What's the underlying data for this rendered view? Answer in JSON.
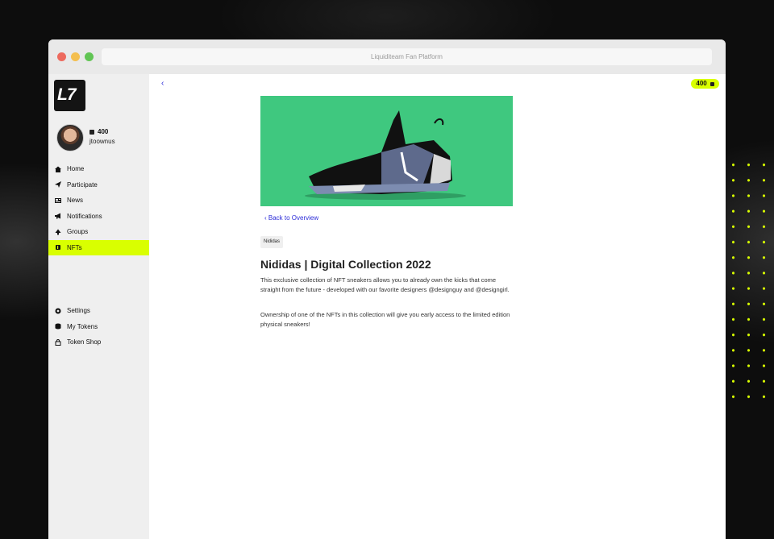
{
  "window": {
    "title": "Liquiditeam Fan Platform"
  },
  "brand": {
    "logo_text": "L7"
  },
  "user": {
    "tokens": "400",
    "username": "jtoownus"
  },
  "nav_main": [
    {
      "label": "Home",
      "icon": "home-icon"
    },
    {
      "label": "Participate",
      "icon": "paper-plane-icon"
    },
    {
      "label": "News",
      "icon": "newspaper-icon"
    },
    {
      "label": "Notifications",
      "icon": "megaphone-icon"
    },
    {
      "label": "Groups",
      "icon": "people-icon"
    },
    {
      "label": "NFTs",
      "icon": "nft-icon",
      "active": true
    }
  ],
  "nav_secondary": [
    {
      "label": "Settings",
      "icon": "gear-icon"
    },
    {
      "label": "My Tokens",
      "icon": "coins-icon"
    },
    {
      "label": "Token Shop",
      "icon": "shopping-bag-icon"
    }
  ],
  "header": {
    "balance": "400"
  },
  "detail": {
    "back_label": "Back to Overview",
    "tag": "Nididas",
    "title": "Nididas | Digital Collection 2022",
    "paragraph_1": "This exclusive collection of NFT sneakers allows you to already own the kicks that come straight from the future - developed with our favorite designers @designguy and @designgirl.",
    "paragraph_2": "Ownership of one of the NFTs in this collection will give you early access to the limited edition physical sneakers!"
  },
  "colors": {
    "accent": "#d9ff00",
    "link": "#2b2bd8",
    "hero_bg": "#3fc87f"
  }
}
